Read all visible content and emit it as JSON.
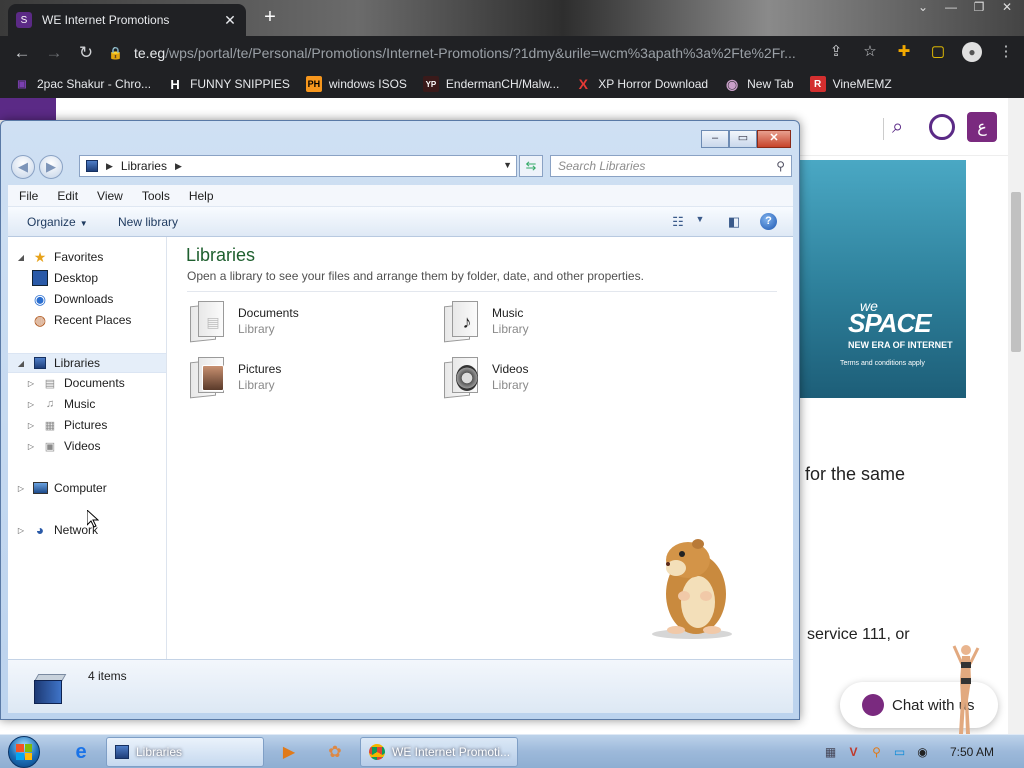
{
  "browser": {
    "tab_title": "WE Internet Promotions",
    "tab_close": "✕",
    "new_tab": "+",
    "url_host": "te.eg",
    "url_path": "/wps/portal/te/Personal/Promotions/Internet-Promotions/?1dmy&urile=wcm%3apath%3a%2Fte%2Fr...",
    "bookmarks": [
      {
        "label": "2pac Shakur - Chro...",
        "icon_text": "▣",
        "color": "#7a3fb0"
      },
      {
        "label": "FUNNY SNIPPIES",
        "icon_text": "H",
        "color": "#ffffff"
      },
      {
        "label": "windows ISOS",
        "icon_text": "PH",
        "color": "#f7971d"
      },
      {
        "label": "EndermanCH/Malw...",
        "icon_text": "YP",
        "color": "#c0392b"
      },
      {
        "label": "XP Horror Download",
        "icon_text": "X",
        "color": "#e53935"
      },
      {
        "label": "New Tab",
        "icon_text": "◉",
        "color": "#9c6b9c"
      },
      {
        "label": "VineMEMZ",
        "icon_text": "R",
        "color": "#d32f2f"
      }
    ]
  },
  "webpage": {
    "lang_button": "ع",
    "banner_we": "we",
    "banner_space": "SPACE",
    "banner_tagline": "NEW ERA OF INTERNET",
    "banner_terms": "Terms and conditions apply",
    "text1": "for the same",
    "text2": "service 111, or",
    "chat_label": "Chat with us"
  },
  "explorer": {
    "address": {
      "crumb": "Libraries"
    },
    "search_placeholder": "Search Libraries",
    "menu": [
      "File",
      "Edit",
      "View",
      "Tools",
      "Help"
    ],
    "commands": {
      "organize": "Organize",
      "new_library": "New library"
    },
    "help_glyph": "?",
    "nav": {
      "favorites": "Favorites",
      "desktop": "Desktop",
      "downloads": "Downloads",
      "recent_places": "Recent Places",
      "libraries": "Libraries",
      "documents": "Documents",
      "music": "Music",
      "pictures": "Pictures",
      "videos": "Videos",
      "computer": "Computer",
      "network": "Network"
    },
    "content": {
      "title": "Libraries",
      "subtitle": "Open a library to see your files and arrange them by folder, date, and other properties.",
      "items": [
        {
          "name": "Documents",
          "type": "Library"
        },
        {
          "name": "Music",
          "type": "Library"
        },
        {
          "name": "Pictures",
          "type": "Library"
        },
        {
          "name": "Videos",
          "type": "Library"
        }
      ]
    },
    "status": {
      "count": "4 items"
    }
  },
  "taskbar": {
    "buttons": [
      {
        "label": "Libraries"
      },
      {
        "label": "WE Internet Promoti..."
      }
    ],
    "clock": "7:50 AM"
  },
  "colors": {
    "accent_purple": "#5b2a86",
    "explorer_title_green": "#1e5f2e"
  }
}
